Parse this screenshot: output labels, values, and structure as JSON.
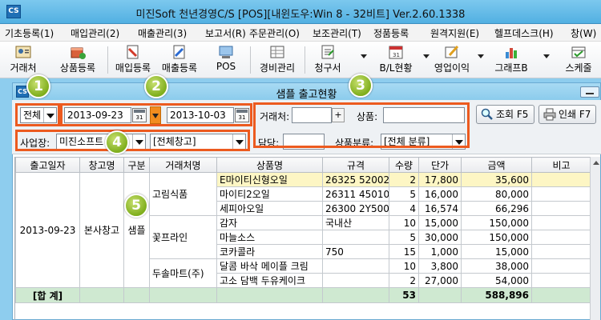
{
  "window": {
    "title": "미진Soft 천년경영C/S [POS][내윈도우:Win 8 - 32비트] Ver.2.60.1338",
    "app_icon_text": "CS"
  },
  "menu": [
    "기초등록(1)",
    "매입관리(2)",
    "매출관리(3)",
    "보고서(R)",
    "주문관리(O)",
    "보조관리(T)",
    "정품등록",
    "원격지원(E)",
    "헬프데스크(H)",
    "창(W)"
  ],
  "toolbar": {
    "items": [
      "거래처",
      "상품등록",
      "매입등록",
      "매출등록",
      "POS",
      "경비관리",
      "청구서",
      "B/L현황",
      "영업이익",
      "그래프B",
      "스케줄"
    ]
  },
  "child_window": {
    "title": "샘플 출고현황",
    "icon_text": "CS"
  },
  "filters": {
    "period_type": "전체",
    "date_from": "2013-09-23",
    "date_to": "2013-10-03",
    "calendar_label": "31",
    "customer_label": "거래처:",
    "customer_value": "",
    "product_label": "상품:",
    "product_value": "",
    "site_label": "사업장:",
    "site_value": "미진소프트",
    "warehouse_value": "[전체창고]",
    "manager_label": "담당:",
    "manager_value": "",
    "category_label": "상품분류:",
    "category_value": "[전체 분류]",
    "search_button": "조회 F5",
    "print_button": "인쇄 F7",
    "plus": "+"
  },
  "badges": [
    "1",
    "2",
    "3",
    "4",
    "5"
  ],
  "table": {
    "columns": [
      "출고일자",
      "창고명",
      "구분",
      "거래처명",
      "상품명",
      "규격",
      "수량",
      "단가",
      "금액",
      "비고"
    ],
    "date": "2013-09-23",
    "warehouse": "본사창고",
    "type": "샘플",
    "customers": [
      "고림식품",
      "꽃프라인",
      "두솔마트(주)"
    ],
    "rows": [
      {
        "product": "E마이티신형오일",
        "spec": "26325 52002",
        "qty": "2",
        "price": "17,800",
        "amount": "35,600"
      },
      {
        "product": "마이티2오일",
        "spec": "26311 45010",
        "qty": "5",
        "price": "16,000",
        "amount": "80,000"
      },
      {
        "product": "세피아오일",
        "spec": "26300 2Y500",
        "qty": "4",
        "price": "16,574",
        "amount": "66,296"
      },
      {
        "product": "감자",
        "spec": "국내산",
        "qty": "10",
        "price": "15,000",
        "amount": "150,000"
      },
      {
        "product": "마늘소스",
        "spec": "",
        "qty": "5",
        "price": "30,000",
        "amount": "150,000"
      },
      {
        "product": "코카콜라",
        "spec": "750",
        "qty": "15",
        "price": "1,000",
        "amount": "15,000"
      },
      {
        "product": "달콤 바삭 메이플 크림",
        "spec": "",
        "qty": "10",
        "price": "3,800",
        "amount": "38,000"
      },
      {
        "product": "고소 담백 두유케이크",
        "spec": "",
        "qty": "2",
        "price": "27,000",
        "amount": "54,000"
      }
    ],
    "total_label": "[합 계]",
    "total_qty": "53",
    "total_amount": "588,896"
  }
}
